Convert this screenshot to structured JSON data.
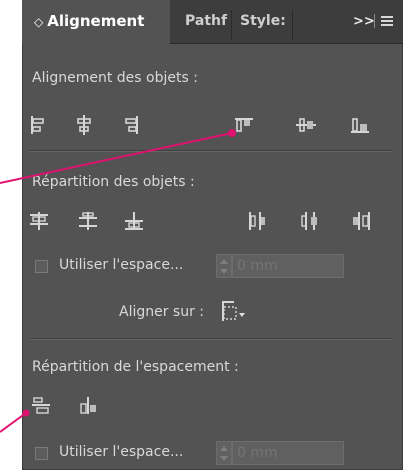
{
  "tabs": [
    {
      "label": "Alignement",
      "active": true
    },
    {
      "label": "Pathf",
      "active": false
    },
    {
      "label": "Style:",
      "active": false
    }
  ],
  "tab_chevron": "◇",
  "overflow_label": ">>",
  "sections": {
    "align_objects": {
      "title": "Alignement des objets :"
    },
    "distribute_objects": {
      "title": "Répartition des objets :"
    },
    "distribute_spacing": {
      "title": "Répartition de l'espacement :"
    }
  },
  "spacing_options": [
    {
      "label": "Utiliser l'espace...",
      "value": "",
      "placeholder": "0 mm"
    },
    {
      "label": "Utiliser l'espace...",
      "value": "",
      "placeholder": "0 mm"
    }
  ],
  "align_to": {
    "label": "Aligner sur :"
  },
  "colors": {
    "panel_bg": "#535353",
    "tab_bg": "#3d3d3d",
    "annotation": "#e0126f",
    "icon": "#d6d6d6",
    "icon_fill": "#bdbdbd"
  }
}
